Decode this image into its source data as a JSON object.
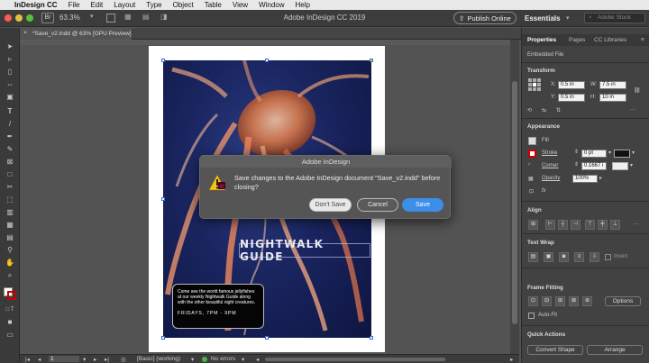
{
  "menubar": {
    "apple": "",
    "app": "InDesign CC",
    "items": [
      "File",
      "Edit",
      "Layout",
      "Type",
      "Object",
      "Table",
      "View",
      "Window",
      "Help"
    ]
  },
  "appbar": {
    "zoom": "63.3%",
    "title": "Adobe InDesign CC 2019",
    "publish": "Publish Online",
    "workspace": "Essentials",
    "search_placeholder": "Adobe Stock"
  },
  "doc": {
    "tab": "*Save_v2.indd @ 63% [GPU Preview]",
    "nw_title": "NIGHTWALK GUIDE",
    "body_text": "Come see the world famous jellyfishes at our weekly Nightwalk Guide along with the other beautiful night creatures.",
    "time": "FRIDAYS, 7PM - 9PM"
  },
  "dialog": {
    "title": "Adobe InDesign",
    "message": "Save changes to the Adobe InDesign document \"Save_v2.indd\" before closing?",
    "dont_save": "Don't Save",
    "cancel": "Cancel",
    "save": "Save"
  },
  "status": {
    "page": "1",
    "style": "[Basic] (working)",
    "errors": "No errors"
  },
  "panel": {
    "tabs": [
      "Properties",
      "Pages",
      "CC Libraries"
    ],
    "embedded": "Embedded File",
    "transform": {
      "title": "Transform",
      "x_label": "X:",
      "x": "0.5 in",
      "y_label": "Y:",
      "y": "0.5 in",
      "w_label": "W:",
      "w": "7.5 in",
      "h_label": "H:",
      "h": "10 in"
    },
    "appearance": {
      "title": "Appearance",
      "fill": "Fill",
      "stroke": "Stroke",
      "stroke_val": "0 pt",
      "corner": "Corner",
      "corner_val": "0.1667 i",
      "opacity": "Opacity",
      "opacity_val": "100%"
    },
    "align": {
      "title": "Align"
    },
    "wrap": {
      "title": "Text Wrap",
      "invert": "Invert"
    },
    "fitting": {
      "title": "Frame Fitting",
      "options": "Options",
      "autofit": "Auto-Fit"
    },
    "quick": {
      "title": "Quick Actions",
      "convert": "Convert Shape",
      "arrange": "Arrange"
    }
  },
  "colors": {
    "accent": "#3d8ee8",
    "canvas": "#535353",
    "panel": "#424242",
    "dialog": "#555555"
  }
}
